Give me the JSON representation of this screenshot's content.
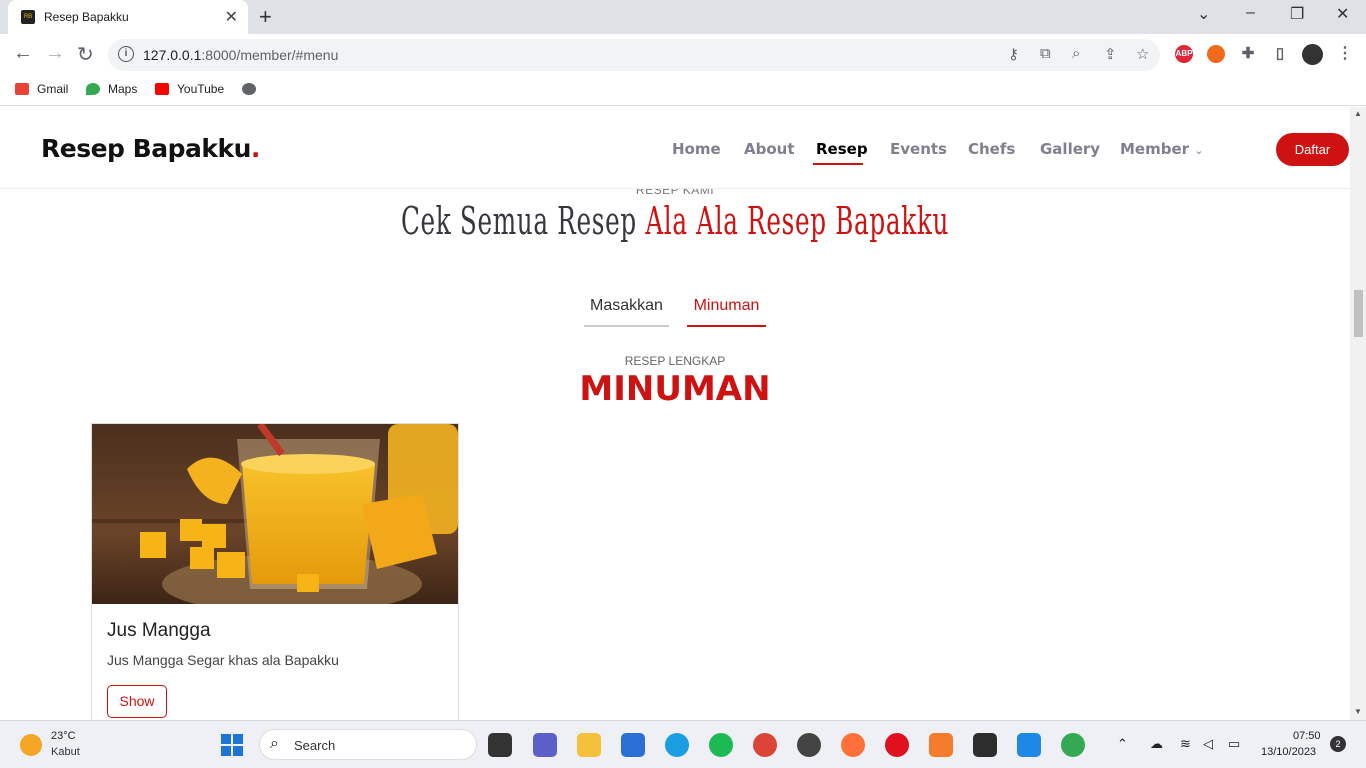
{
  "browser": {
    "tab_title": "Resep Bapakku",
    "tab_favicon_text": "RB",
    "url_host": "127.0.0.1",
    "url_rest": ":8000/member/#menu",
    "bookmarks": [
      "Gmail",
      "Maps",
      "YouTube"
    ],
    "abp_label": "ABP"
  },
  "site": {
    "logo": "Resep Bapakku",
    "logo_dot": ".",
    "nav": [
      "Home",
      "About",
      "Resep",
      "Events",
      "Chefs",
      "Gallery",
      "Member"
    ],
    "nav_active": "Resep",
    "cta": "Daftar"
  },
  "section": {
    "subtitle": "RESEP KAMI",
    "title_a": "Cek Semua Resep",
    "title_b": "Ala Ala Resep Bapakku",
    "tabs": [
      "Masakkan",
      "Minuman"
    ],
    "tab_active": "Minuman",
    "sub2": "RESEP LENGKAP",
    "big_title": "MINUMAN"
  },
  "card": {
    "title": "Jus Mangga",
    "desc": "Jus Mangga Segar khas ala Bapakku",
    "button": "Show"
  },
  "taskbar": {
    "temp": "23°C",
    "cond": "Kabut",
    "search": "Search",
    "time": "07:50",
    "date": "13/10/2023",
    "notifications": "2"
  }
}
